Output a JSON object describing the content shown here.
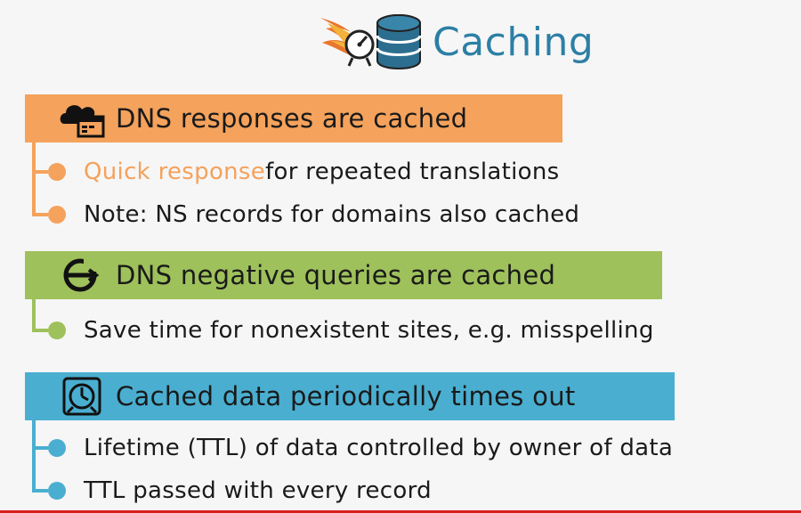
{
  "title": "Caching",
  "colors": {
    "orange": "#f4a25c",
    "green": "#9ec15b",
    "blue": "#4aaed0",
    "title": "#2c7fa5"
  },
  "sections": [
    {
      "heading": "DNS responses are cached",
      "icon": "cloud-browser-icon",
      "bullets": [
        {
          "highlight": "Quick response",
          "text": " for repeated translations"
        },
        {
          "text": "Note: NS records for domains also cached"
        }
      ]
    },
    {
      "heading": "DNS negative queries are cached",
      "icon": "negative-query-icon",
      "bullets": [
        {
          "text": "Save time for nonexistent sites, e.g. misspelling"
        }
      ]
    },
    {
      "heading": "Cached data periodically times out",
      "icon": "timer-icon",
      "bullets": [
        {
          "text": "Lifetime (TTL) of data controlled by owner of data"
        },
        {
          "text": "TTL passed with every record"
        }
      ]
    }
  ]
}
